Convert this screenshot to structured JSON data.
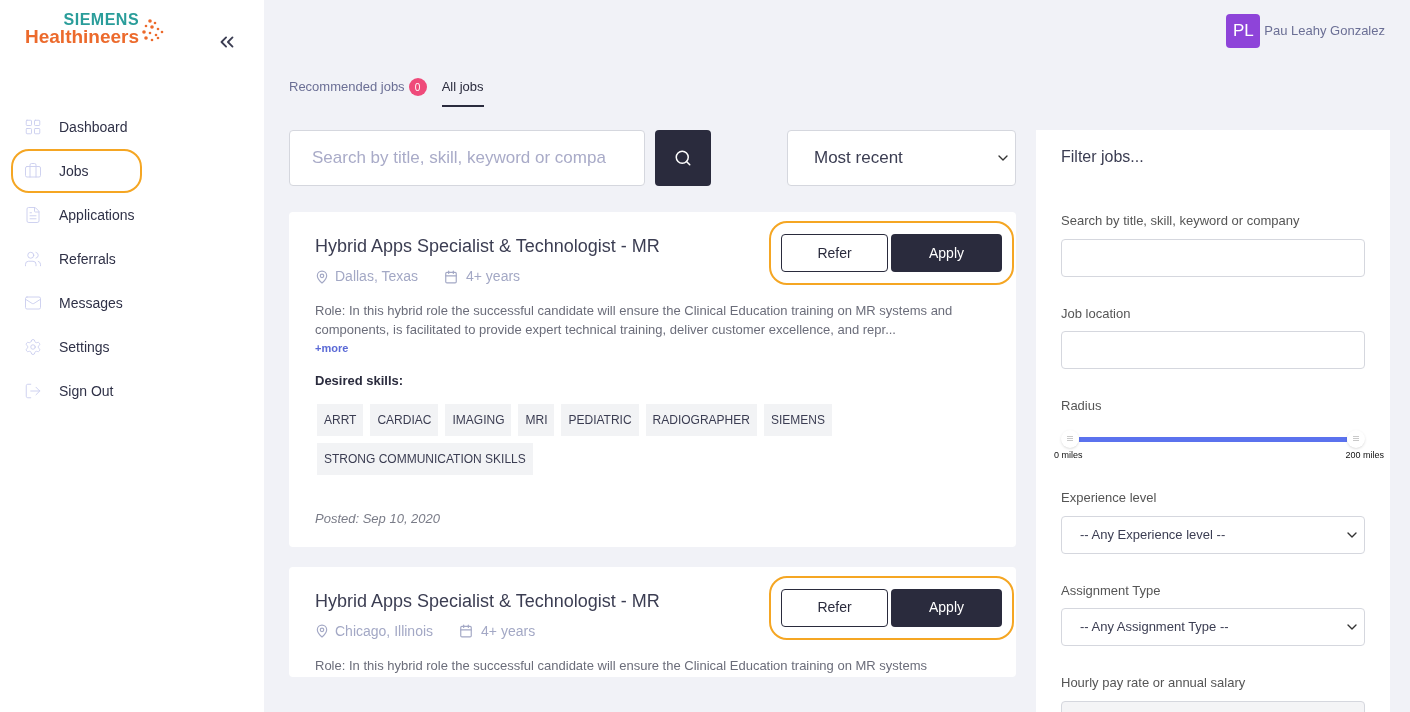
{
  "logo": {
    "brand": "SIEMENS",
    "product": "Healthineers"
  },
  "sidebar": {
    "items": [
      {
        "label": "Dashboard",
        "highlighted": false
      },
      {
        "label": "Jobs",
        "highlighted": true
      },
      {
        "label": "Applications",
        "highlighted": false
      },
      {
        "label": "Referrals",
        "highlighted": false
      },
      {
        "label": "Messages",
        "highlighted": false
      },
      {
        "label": "Settings",
        "highlighted": false
      },
      {
        "label": "Sign Out",
        "highlighted": false
      }
    ]
  },
  "user": {
    "initials": "PL",
    "name": "Pau Leahy Gonzalez"
  },
  "tabs": [
    {
      "label": "Recommended jobs",
      "badge": "0",
      "selected": false
    },
    {
      "label": "All jobs",
      "selected": true
    }
  ],
  "search": {
    "placeholder": "Search by title, skill, keyword or compa"
  },
  "sort": {
    "value": "Most recent"
  },
  "jobs": [
    {
      "title": "Hybrid Apps Specialist & Technologist - MR",
      "location": "Dallas, Texas",
      "experience": "4+ years",
      "highlighted": true,
      "refer": "Refer",
      "apply": "Apply",
      "description": "Role: In this hybrid role the successful candidate will ensure the Clinical Education training on MR systems and components, is facilitated to provide expert technical training, deliver customer excellence, and repr...",
      "more": "+more",
      "skills_label": "Desired skills:",
      "skills": [
        "ARRT",
        "CARDIAC",
        "IMAGING",
        "MRI",
        "PEDIATRIC",
        "RADIOGRAPHER",
        "SIEMENS",
        "STRONG COMMUNICATION SKILLS"
      ],
      "posted": "Posted: Sep 10, 2020"
    },
    {
      "title": "Hybrid Apps Specialist & Technologist - MR",
      "location": "Chicago, Illinois",
      "experience": "4+ years",
      "highlighted": true,
      "refer": "Refer",
      "apply": "Apply",
      "description": "Role: In this hybrid role the successful candidate will ensure the Clinical Education training on MR systems"
    }
  ],
  "filters": {
    "title": "Filter jobs...",
    "search_label": "Search by title, skill, keyword or company",
    "location_label": "Job location",
    "radius": {
      "label": "Radius",
      "level": 1,
      "min_label": "0 miles",
      "max_label": "200 miles"
    },
    "experience": {
      "label": "Experience level",
      "value": "-- Any Experience level --"
    },
    "assignment": {
      "label": "Assignment Type",
      "value": "-- Any Assignment Type --"
    },
    "salary_label": "Hourly pay rate or annual salary"
  }
}
